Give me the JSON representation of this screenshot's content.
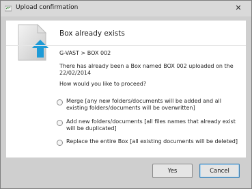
{
  "window": {
    "title": "Upload confirmation",
    "close_glyph": "✕"
  },
  "dialog": {
    "heading": "Box already exists",
    "path": "G-VAST > BOX 002",
    "message": "There has already been a Box named BOX 002 uploaded on the 22/02/2014",
    "question": "How would you like to proceed?",
    "options": [
      {
        "label": "Merge [any new folders/documents will be added and all existing folders/documents will be overwritten]",
        "selected": false
      },
      {
        "label": "Add new folders/documents [all files names that already exist will be duplicated]",
        "selected": false
      },
      {
        "label": "Replace the entire Box [all existing documents will be deleted]",
        "selected": false
      }
    ],
    "icon": "document-upload-icon"
  },
  "buttons": {
    "yes": "Yes",
    "cancel": "Cancel"
  },
  "colors": {
    "upload_arrow": "#1e9bd7",
    "content_bg": "#ffffff",
    "chrome_bg": "#cfcfcf"
  }
}
